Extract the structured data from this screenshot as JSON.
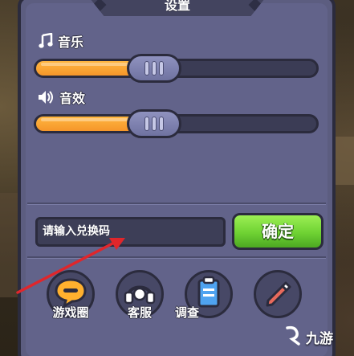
{
  "dialog": {
    "title": "设置"
  },
  "music": {
    "label": "音乐",
    "icon": "music-note-icon",
    "level": 0.42
  },
  "sound": {
    "label": "音效",
    "icon": "speaker-icon",
    "level": 0.42
  },
  "redeem": {
    "placeholder": "请输入兑换码",
    "confirm_label": "确定"
  },
  "shortcuts": [
    {
      "label": "游戏圈",
      "icon": "chat-bubble-icon"
    },
    {
      "label": "客服",
      "icon": "headset-icon"
    },
    {
      "label": "调查",
      "icon": "survey-clipboard-icon"
    },
    {
      "label": "",
      "icon": "pencil-icon"
    }
  ],
  "watermark": {
    "text": "九游"
  },
  "colors": {
    "panel": "#5c5d80",
    "slider_fill": "#f5962a",
    "confirm_button": "#6fd233",
    "annotation_arrow": "#e0262b"
  }
}
